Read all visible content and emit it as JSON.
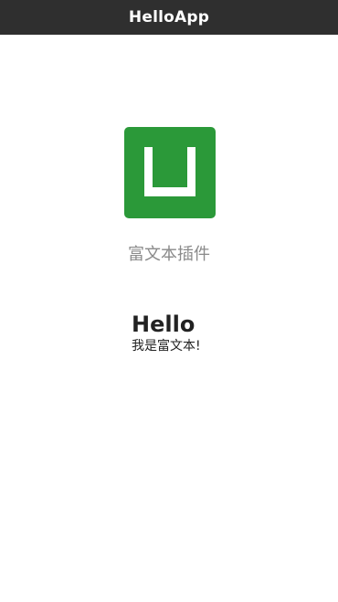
{
  "nav": {
    "title": "HelloApp"
  },
  "logo": {
    "icon": "uniapp-logo-icon",
    "color": "#2b9939"
  },
  "content": {
    "plugin_title": "富文本插件",
    "rich_heading": "Hello",
    "rich_body": "我是富文本!"
  }
}
